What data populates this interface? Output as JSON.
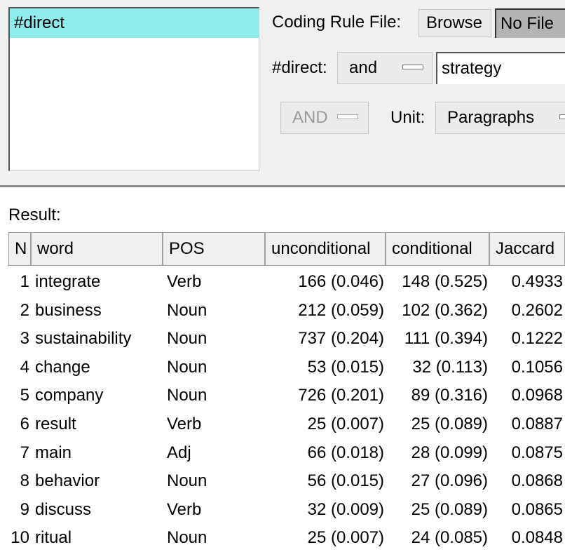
{
  "codes": {
    "items": [
      "#direct"
    ]
  },
  "rule_file": {
    "label": "Coding Rule File:",
    "browse_label": "Browse",
    "file_value": "No File"
  },
  "condition": {
    "label": "#direct:",
    "operator": "and",
    "value": "strategy"
  },
  "options": {
    "bool_operator": "AND",
    "unit_label": "Unit:",
    "unit_value": "Paragraphs"
  },
  "result": {
    "label": "Result:",
    "columns": [
      "N",
      "word",
      "POS",
      "unconditional",
      "conditional",
      "Jaccard"
    ],
    "rows": [
      {
        "n": "1",
        "word": "integrate",
        "pos": "Verb",
        "unconditional": "166 (0.046)",
        "conditional": "148 (0.525)",
        "jaccard": "0.4933"
      },
      {
        "n": "2",
        "word": "business",
        "pos": "Noun",
        "unconditional": "212 (0.059)",
        "conditional": "102 (0.362)",
        "jaccard": "0.2602"
      },
      {
        "n": "3",
        "word": "sustainability",
        "pos": "Noun",
        "unconditional": "737 (0.204)",
        "conditional": "111 (0.394)",
        "jaccard": "0.1222"
      },
      {
        "n": "4",
        "word": "change",
        "pos": "Noun",
        "unconditional": "53 (0.015)",
        "conditional": "32 (0.113)",
        "jaccard": "0.1056"
      },
      {
        "n": "5",
        "word": "company",
        "pos": "Noun",
        "unconditional": "726 (0.201)",
        "conditional": "89 (0.316)",
        "jaccard": "0.0968"
      },
      {
        "n": "6",
        "word": "result",
        "pos": "Verb",
        "unconditional": "25 (0.007)",
        "conditional": "25 (0.089)",
        "jaccard": "0.0887"
      },
      {
        "n": "7",
        "word": "main",
        "pos": "Adj",
        "unconditional": "66 (0.018)",
        "conditional": "28 (0.099)",
        "jaccard": "0.0875"
      },
      {
        "n": "8",
        "word": "behavior",
        "pos": "Noun",
        "unconditional": "56 (0.015)",
        "conditional": "27 (0.096)",
        "jaccard": "0.0868"
      },
      {
        "n": "9",
        "word": "discuss",
        "pos": "Verb",
        "unconditional": "32 (0.009)",
        "conditional": "25 (0.089)",
        "jaccard": "0.0865"
      },
      {
        "n": "10",
        "word": "ritual",
        "pos": "Noun",
        "unconditional": "25 (0.007)",
        "conditional": "24 (0.085)",
        "jaccard": "0.0848"
      }
    ]
  }
}
